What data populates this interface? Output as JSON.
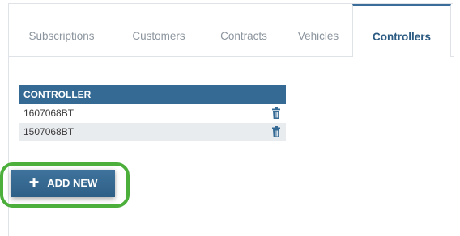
{
  "tabs": [
    {
      "label": "Subscriptions",
      "active": false
    },
    {
      "label": "Customers",
      "active": false
    },
    {
      "label": "Contracts",
      "active": false
    },
    {
      "label": "Vehicles",
      "active": false
    },
    {
      "label": "Controllers",
      "active": true
    }
  ],
  "table": {
    "header": "CONTROLLER",
    "rows": [
      {
        "value": "1607068BT",
        "action_icon": "trash-icon"
      },
      {
        "value": "1507068BT",
        "action_icon": "trash-icon"
      }
    ]
  },
  "add_button": {
    "icon": "plus-icon",
    "label": "ADD NEW"
  },
  "colors": {
    "accent": "#356a94",
    "highlight": "#4caf3c"
  }
}
